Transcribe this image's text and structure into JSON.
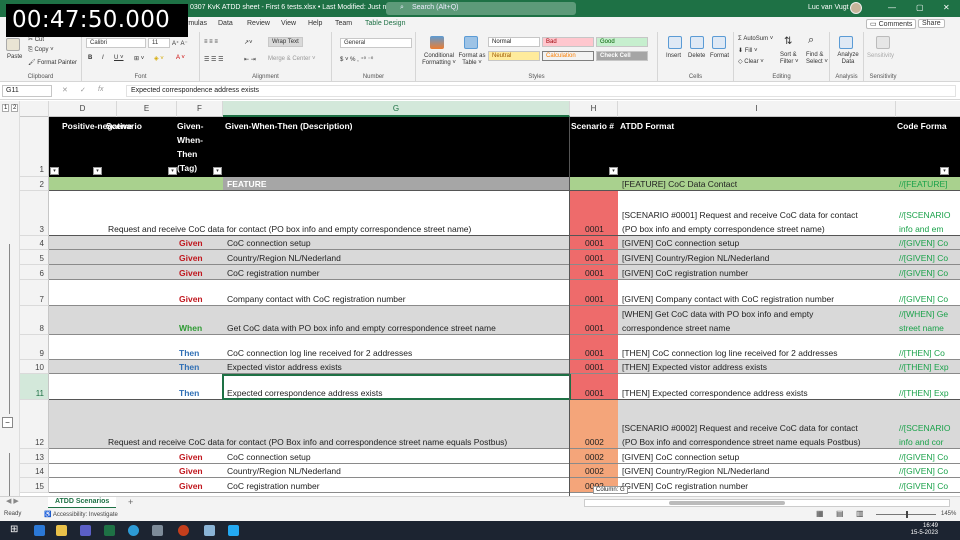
{
  "timer": "00:47:50.000",
  "window": {
    "document_title": "0307 KvK ATDD sheet - First 6 tests.xlsx • Last Modified: Just now ˅",
    "search_placeholder": "Search (Alt+Q)",
    "user_name": "Luc van Vugt",
    "minimize": "—",
    "maximize": "▢",
    "close": "✕"
  },
  "menu": {
    "tabs": [
      "rmulas",
      "Data",
      "Review",
      "View",
      "Help",
      "Team",
      "Table Design"
    ],
    "comments": "Comments",
    "share": "Share"
  },
  "ribbon": {
    "clipboard": {
      "paste": "Paste",
      "cut": "Cut",
      "copy": "Copy ˅",
      "format_painter": "Format Painter",
      "label": "Clipboard"
    },
    "font": {
      "name": "Calibri",
      "size": "11",
      "bold": "B",
      "italic": "I",
      "underline": "U ˅",
      "label": "Font"
    },
    "alignment": {
      "wrap_text": "Wrap Text",
      "merge": "Merge & Center ˅",
      "label": "Alignment"
    },
    "number": {
      "format": "General",
      "label": "Number"
    },
    "styles": {
      "conditional": "Conditional Formatting ˅",
      "format_table": "Format as Table ˅",
      "cells": [
        "Normal",
        "Bad",
        "Good",
        "Neutral",
        "Calculation",
        "Check Cell"
      ],
      "label": "Styles"
    },
    "cells": {
      "insert": "Insert",
      "delete": "Delete",
      "format": "Format",
      "label": "Cells"
    },
    "editing": {
      "autosum": "AutoSum ˅",
      "fill": "Fill ˅",
      "clear": "Clear ˅",
      "sort": "Sort & Filter ˅",
      "find": "Find & Select ˅",
      "label": "Editing"
    },
    "analysis": {
      "analyze": "Analyze Data",
      "label": "Analysis"
    },
    "sensitivity": {
      "btn": "Sensitivity",
      "label": "Sensitivity"
    }
  },
  "formula_bar": {
    "name_box": "G11",
    "cancel": "✕",
    "enter": "✓",
    "fx": "fx",
    "content": "Expected correspondence address exists"
  },
  "outline_levels": [
    "1",
    "2"
  ],
  "columns": [
    "D",
    "E",
    "F",
    "G",
    "H",
    "I"
  ],
  "header_row": {
    "D": "Positive-negative",
    "E": "Scenario",
    "F": "Given-When-Then (Tag)",
    "G": "Given-When-Then (Description)",
    "H": "Scenario #",
    "I": "ATDD Format",
    "J": "Code Forma"
  },
  "rows": [
    {
      "num": "2",
      "E": "",
      "F": "",
      "G": "FEATURE",
      "H": "",
      "I": "[FEATURE] CoC Data Contact",
      "J": "//[FEATURE] "
    },
    {
      "num": "3",
      "E": "Request and receive CoC data for contact (PO box info and empty correspondence street name)",
      "F": "",
      "G": "",
      "H": "0001",
      "I": "[SCENARIO #0001] Request and receive CoC data for contact",
      "I2": "(PO box info and empty correspondence street name)",
      "J": "//[SCENARIO",
      "J2": "info and em"
    },
    {
      "num": "4",
      "F": "Given",
      "G": "CoC connection setup",
      "H": "0001",
      "I": "[GIVEN] CoC connection setup",
      "J": "//[GIVEN] Co"
    },
    {
      "num": "5",
      "F": "Given",
      "G": "Country/Region NL/Nederland",
      "H": "0001",
      "I": "[GIVEN] Country/Region NL/Nederland",
      "J": "//[GIVEN] Co"
    },
    {
      "num": "6",
      "F": "Given",
      "G": "CoC registration number",
      "H": "0001",
      "I": "[GIVEN] CoC registration number",
      "J": "//[GIVEN] Co"
    },
    {
      "num": "7",
      "F": "Given",
      "G": "Company  contact with CoC registration number",
      "H": "0001",
      "I": "[GIVEN] Company  contact with CoC registration number",
      "J": "//[GIVEN] Co"
    },
    {
      "num": "8",
      "F": "When",
      "G": "Get CoC data with PO box info and empty correspondence street name",
      "H": "0001",
      "I": "[WHEN] Get CoC data with PO box info and empty",
      "I2": "correspondence street name",
      "J": "//[WHEN] Ge",
      "J2": "street name"
    },
    {
      "num": "9",
      "F": "Then",
      "G": "CoC connection log line received for 2 addresses",
      "H": "0001",
      "I": "[THEN] CoC connection log line received for 2 addresses",
      "J": "//[THEN] Co"
    },
    {
      "num": "10",
      "F": "Then",
      "G": "Expected vistor address exists",
      "H": "0001",
      "I": "[THEN] Expected vistor address exists",
      "J": "//[THEN] Exp"
    },
    {
      "num": "11",
      "F": "Then",
      "G": "Expected correspondence address exists",
      "H": "0001",
      "I": "[THEN] Expected correspondence address exists",
      "J": "//[THEN] Exp"
    },
    {
      "num": "12",
      "E": "Request and receive CoC data for contact (PO Box info and correspondence street name equals Postbus)",
      "H": "0002",
      "I": "[SCENARIO #0002] Request and receive CoC data for contact",
      "I2": "(PO Box info and correspondence street name equals Postbus)",
      "J": "//[SCENARIO",
      "J2": "info and cor"
    },
    {
      "num": "13",
      "F": "Given",
      "G": "CoC connection setup",
      "H": "0002",
      "I": "[GIVEN] CoC connection setup",
      "J": "//[GIVEN] Co"
    },
    {
      "num": "14",
      "F": "Given",
      "G": "Country/Region NL/Nederland",
      "H": "0002",
      "I": "[GIVEN] Country/Region NL/Nederland",
      "J": "//[GIVEN] Co"
    },
    {
      "num": "15",
      "F": "Given",
      "G": "CoC registration number",
      "H": "0002",
      "I": "[GIVEN] CoC registration number",
      "J": "//[GIVEN] Co"
    }
  ],
  "row1_num": "1",
  "tooltip": "Column: G",
  "sheet_tab": "ATDD Scenarios",
  "add_sheet": "+",
  "status": {
    "ready": "Ready",
    "accessibility": "Accessibility: Investigate",
    "zoom": "145%"
  },
  "clock": {
    "time": "16:49",
    "date": "15-5-2023"
  },
  "colors": {
    "excel_green": "#1e7145",
    "scenario_red": "#ee6b6b",
    "scenario_orange": "#f4a57a",
    "feature_green": "#a9d18e",
    "header_black": "#000000"
  }
}
